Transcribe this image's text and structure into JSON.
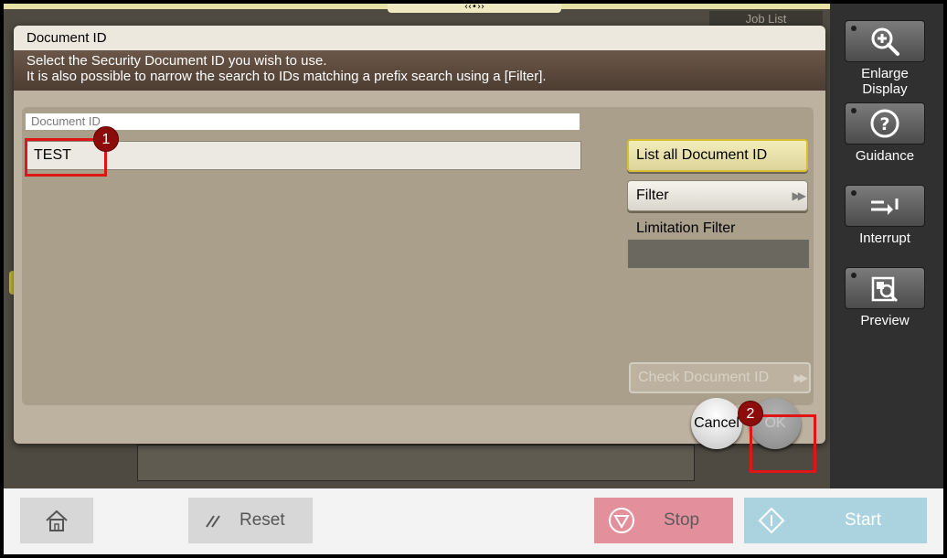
{
  "background": {
    "job_list_label": "Job List",
    "handle_glyph": "‹‹•››"
  },
  "side_panel": {
    "buttons": [
      {
        "label": "Enlarge Display",
        "icon": "zoom-in-icon"
      },
      {
        "label": "Guidance",
        "icon": "help-icon"
      },
      {
        "label": "Interrupt",
        "icon": "interrupt-icon"
      },
      {
        "label": "Preview",
        "icon": "preview-icon"
      }
    ]
  },
  "dialog": {
    "title": "Document ID",
    "instruction_line1": "Select the Security Document ID you wish to use.",
    "instruction_line2": "It is also possible to narrow the search to IDs matching a prefix search using a [Filter].",
    "field_label": "Document ID",
    "field_value": "TEST",
    "list_all_label": "List all Document ID",
    "filter_label": "Filter",
    "limitation_filter_label": "Limitation Filter",
    "limitation_filter_value": "",
    "check_document_label": "Check Document ID",
    "cancel_label": "Cancel",
    "ok_label": "OK"
  },
  "annotations": {
    "badge1": "1",
    "badge2": "2",
    "highlight_color": "#e01515"
  },
  "bottom_bar": {
    "reset_label": "Reset",
    "stop_label": "Stop",
    "start_label": "Start",
    "stop_color": "#e4909c",
    "start_color": "#abd3df"
  }
}
